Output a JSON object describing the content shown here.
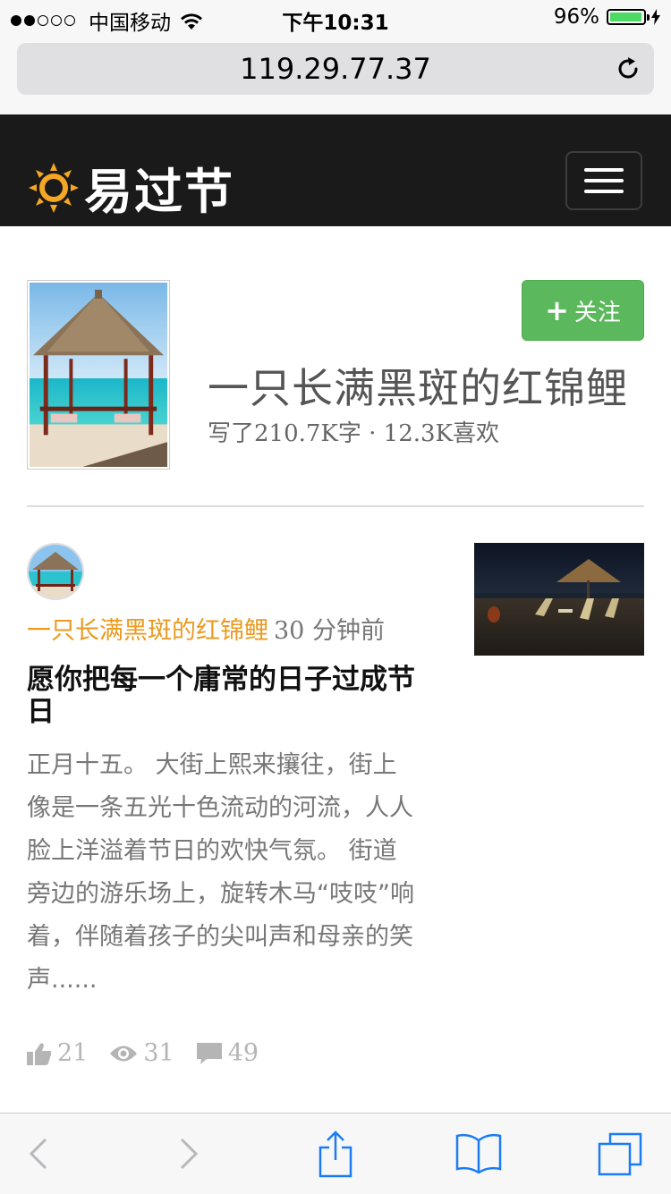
{
  "status_bar": {
    "carrier": "中国移动",
    "time": "下午10:31",
    "battery": "96%",
    "battery_level": 0.96
  },
  "browser": {
    "url": "119.29.77.37",
    "reload_icon": "reload-icon"
  },
  "site": {
    "brand": "易过节",
    "logo_icon": "sun-icon",
    "menu_icon": "hamburger-icon"
  },
  "profile": {
    "name": "一只长满黑斑的红锦鲤",
    "stats": "写了210.7K字 · 12.3K喜欢",
    "follow_label": "关注"
  },
  "article": {
    "author": "一只长满黑斑的红锦鲤",
    "time": "30 分钟前",
    "title": "愿你把每一个庸常的日子过成节日",
    "abstract": "正月十五。 大街上熙来攘往，街上像是一条五光十色流动的河流，人人脸上洋溢着节日的欢快气氛。 街道旁边的游乐场上，旋转木马“吱吱”响着，伴随着孩子的尖叫声和母亲的笑声......",
    "likes": "21",
    "views": "31",
    "comments": "49"
  },
  "colors": {
    "accent": "#ea9a1f",
    "follow": "#5cb85c",
    "nav_bg": "#1a1a1a",
    "ios_blue": "#1a7cf5"
  }
}
